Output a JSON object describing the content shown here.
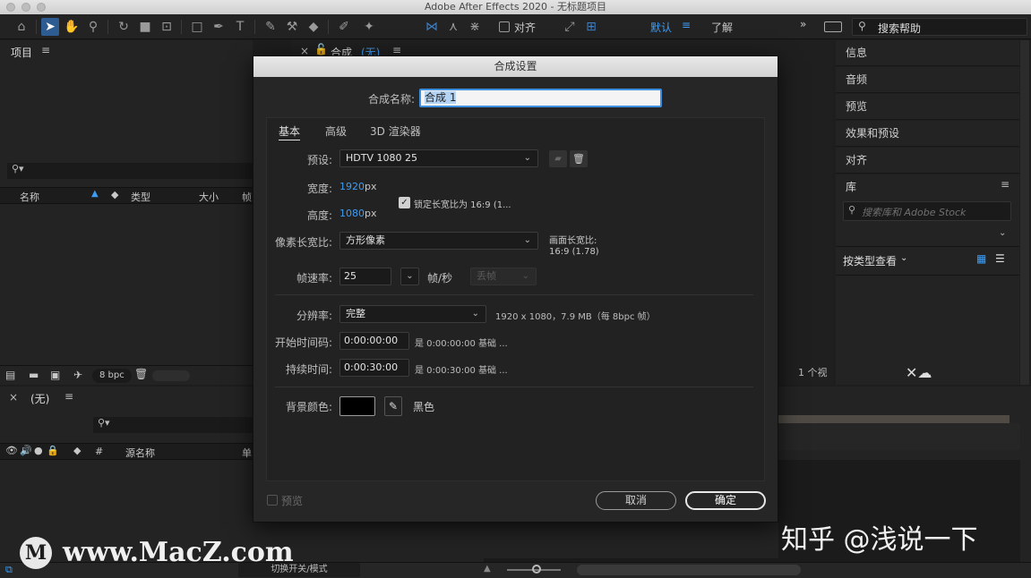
{
  "window": {
    "title": "Adobe After Effects 2020 - 无标题项目"
  },
  "toolbar": {
    "align_label": "对齐",
    "workspace_default": "默认",
    "workspace_learn": "了解",
    "search_help": "搜索帮助"
  },
  "project_panel": {
    "title": "项目",
    "search_placeholder": "",
    "columns": [
      "名称",
      "类型",
      "大小",
      "帧"
    ],
    "bpc": "8 bpc"
  },
  "comp_panel": {
    "title": "合成",
    "name": "(无)",
    "status": "1 个视"
  },
  "timeline": {
    "name": "(无)",
    "column_source": "源名称",
    "column_hash": "#",
    "column_unit": "单",
    "toggle_label": "切换开关/模式"
  },
  "sidebar": {
    "items": [
      "信息",
      "音频",
      "预览",
      "效果和预设",
      "对齐"
    ],
    "library_title": "库",
    "library_search_placeholder": "搜索库和 Adobe Stock",
    "view_by_type": "按类型查看"
  },
  "dialog": {
    "title": "合成设置",
    "comp_name_label": "合成名称:",
    "comp_name_value": "合成 1",
    "tabs": [
      "基本",
      "高级",
      "3D 渲染器"
    ],
    "preset_label": "预设:",
    "preset_value": "HDTV 1080 25",
    "width_label": "宽度:",
    "width_value": "1920",
    "height_label": "高度:",
    "height_value": "1080",
    "px": "px",
    "lock_ratio": "锁定长宽比为 16:9 (1...",
    "pixel_ratio_label": "像素长宽比:",
    "pixel_ratio_value": "方形像素",
    "frame_ratio_label": "画面长宽比:",
    "frame_ratio_value": "16:9 (1.78)",
    "fps_label": "帧速率:",
    "fps_value": "25",
    "fps_unit": "帧/秒",
    "drop_frame": "丢帧",
    "resolution_label": "分辨率:",
    "resolution_value": "完整",
    "resolution_info": "1920 x 1080，7.9 MB（每 8bpc 帧）",
    "start_tc_label": "开始时间码:",
    "start_tc_value": "0:00:00:00",
    "start_tc_info": "是 0:00:00:00  基础 ...",
    "duration_label": "持续时间:",
    "duration_value": "0:00:30:00",
    "duration_info": "是 0:00:30:00  基础 ...",
    "bg_color_label": "背景颜色:",
    "bg_color_name": "黑色",
    "bg_color": "#000000",
    "preview_label": "预览",
    "cancel_label": "取消",
    "ok_label": "确定"
  },
  "watermark": {
    "site": "www.MacZ.com",
    "author": "知乎 @浅说一下"
  }
}
